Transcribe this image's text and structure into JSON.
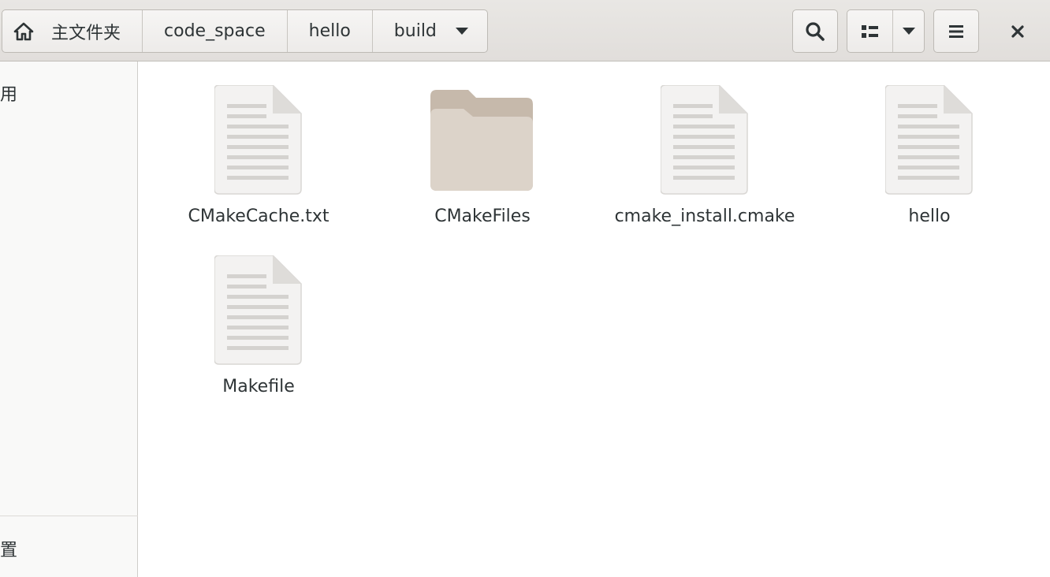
{
  "breadcrumb": {
    "home_label": "主文件夹",
    "items": [
      "code_space",
      "hello",
      "build"
    ]
  },
  "sidebar": {
    "top_label": "用",
    "bottom_label": "置"
  },
  "files": [
    {
      "name": "CMakeCache.txt",
      "type": "text-file"
    },
    {
      "name": "CMakeFiles",
      "type": "folder"
    },
    {
      "name": "cmake_install.cmake",
      "type": "text-file"
    },
    {
      "name": "hello",
      "type": "text-file"
    },
    {
      "name": "Makefile",
      "type": "text-file"
    }
  ],
  "colors": {
    "folder": "#dcd3c9",
    "folder_tab": "#c6b9ab",
    "document": "#f3f2f1"
  }
}
